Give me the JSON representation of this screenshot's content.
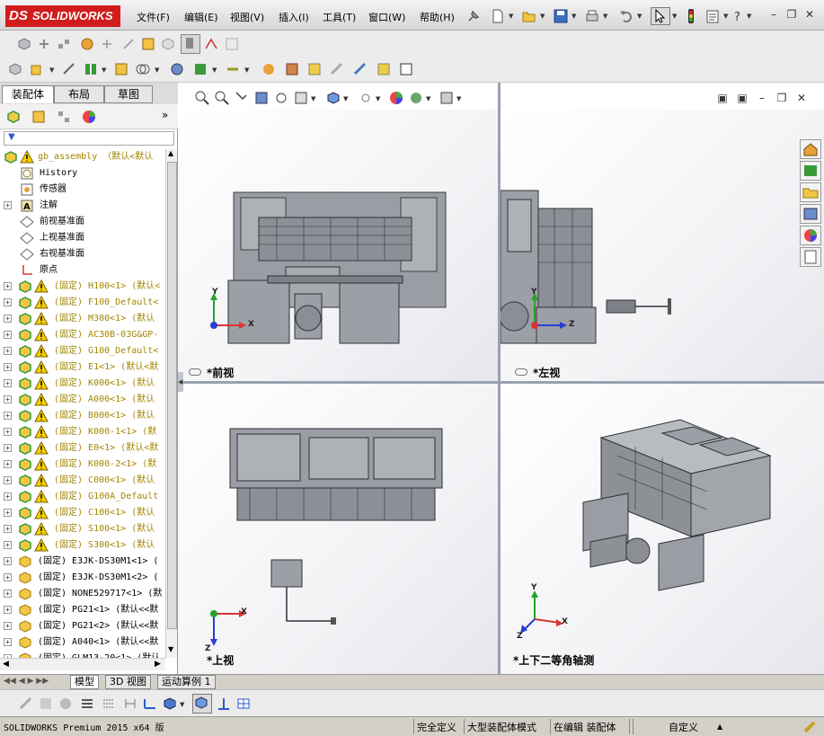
{
  "app": {
    "brand": "SOLIDWORKS",
    "brand_prefix": "DS"
  },
  "menu": [
    {
      "label": "文件(F)"
    },
    {
      "label": "编辑(E)"
    },
    {
      "label": "视图(V)"
    },
    {
      "label": "插入(I)"
    },
    {
      "label": "工具(T)"
    },
    {
      "label": "窗口(W)"
    },
    {
      "label": "帮助(H)"
    }
  ],
  "panel_tabs": [
    {
      "label": "装配体"
    },
    {
      "label": "布局"
    },
    {
      "label": "草图"
    }
  ],
  "tree": {
    "root": "gb_assembly （默认<默认",
    "items": [
      {
        "kind": "feature",
        "label": "History",
        "icon": "history-icon"
      },
      {
        "kind": "feature",
        "label": "传感器",
        "icon": "sensor-icon"
      },
      {
        "kind": "feature",
        "label": "注解",
        "icon": "annotation-icon",
        "expand": true
      },
      {
        "kind": "feature",
        "label": "前视基准面",
        "icon": "plane-icon"
      },
      {
        "kind": "feature",
        "label": "上视基准面",
        "icon": "plane-icon"
      },
      {
        "kind": "feature",
        "label": "右视基准面",
        "icon": "plane-icon"
      },
      {
        "kind": "feature",
        "label": "原点",
        "icon": "origin-icon"
      },
      {
        "kind": "sub",
        "label": "(固定) H100<1> (默认<"
      },
      {
        "kind": "sub",
        "label": "(固定) F100_Default<"
      },
      {
        "kind": "sub",
        "label": "(固定) M300<1> (默认"
      },
      {
        "kind": "sub",
        "label": "(固定) AC30B-03G&GP-"
      },
      {
        "kind": "sub",
        "label": "(固定) G100_Default<"
      },
      {
        "kind": "sub",
        "label": "(固定) E1<1> (默认<默"
      },
      {
        "kind": "sub",
        "label": "(固定) K000<1> (默认"
      },
      {
        "kind": "sub",
        "label": "(固定) A000<1> (默认"
      },
      {
        "kind": "sub",
        "label": "(固定) B000<1> (默认"
      },
      {
        "kind": "sub",
        "label": "(固定) K000-1<1> (默"
      },
      {
        "kind": "sub",
        "label": "(固定) E0<1> (默认<默"
      },
      {
        "kind": "sub",
        "label": "(固定) K000-2<1> (默"
      },
      {
        "kind": "sub",
        "label": "(固定) C000<1> (默认"
      },
      {
        "kind": "sub",
        "label": "(固定) G100A_Default"
      },
      {
        "kind": "sub",
        "label": "(固定) C100<1> (默认"
      },
      {
        "kind": "sub",
        "label": "(固定) S100<1> (默认"
      },
      {
        "kind": "sub",
        "label": "(固定) S300<1> (默认"
      },
      {
        "kind": "part",
        "label": "(固定) E3JK-DS30M1<1> ("
      },
      {
        "kind": "part",
        "label": "(固定) E3JK-DS30M1<2> ("
      },
      {
        "kind": "part",
        "label": "(固定) NONE529717<1> (默"
      },
      {
        "kind": "part",
        "label": "(固定) PG21<1> (默认<<默"
      },
      {
        "kind": "part",
        "label": "(固定) PG21<2> (默认<<默"
      },
      {
        "kind": "part",
        "label": "(固定) A040<1> (默认<<默"
      },
      {
        "kind": "part",
        "label": "(固定) GLM13-20<1> (默认"
      }
    ]
  },
  "viewports": {
    "front": "*前视",
    "left": "*左视",
    "top": "*上视",
    "iso": "*上下二等角轴测"
  },
  "axes": {
    "x": "X",
    "y": "Y",
    "z": "Z"
  },
  "bottom_tabs": [
    {
      "label": "模型"
    },
    {
      "label": "3D 视图"
    },
    {
      "label": "运动算例 1"
    }
  ],
  "status": {
    "version": "SOLIDWORKS Premium 2015 x64 版",
    "defined": "完全定义",
    "mode": "大型装配体模式",
    "editing": "在编辑 装配体",
    "custom": "自定义",
    "up_arrow": "▲"
  },
  "colors": {
    "accent": "#d11c1c",
    "machine": "#8d9196",
    "machine_dark": "#5a5f66",
    "component_text": "#a28600"
  }
}
